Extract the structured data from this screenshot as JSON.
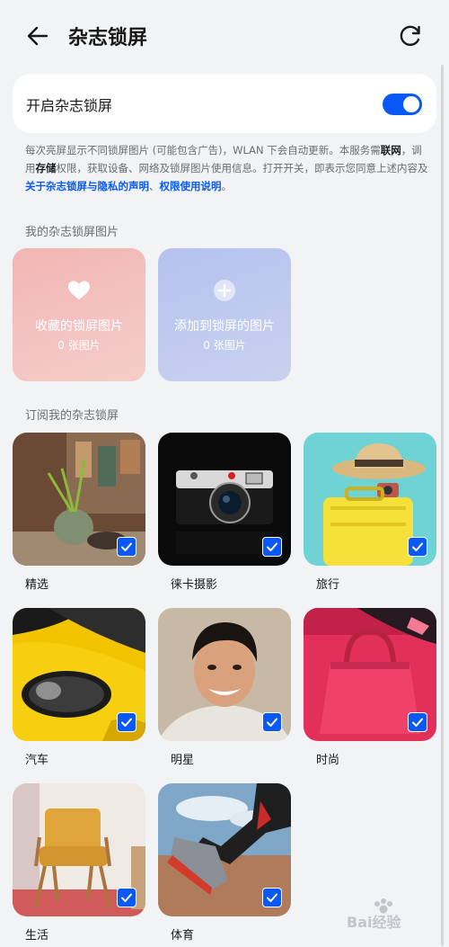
{
  "header": {
    "back_icon": "arrow-left-icon",
    "title": "杂志锁屏",
    "refresh_icon": "refresh-icon"
  },
  "toggle": {
    "label": "开启杂志锁屏",
    "enabled": true,
    "accent_color": "#0a59f7"
  },
  "description": {
    "part1": "每次亮屏显示不同锁屏图片 (可能包含广告)，WLAN 下会自动更新。本服务需",
    "bold1": "联网",
    "part2": "，调用",
    "bold2": "存储",
    "part3": "权限，获取设备、网络及锁屏图片使用信息。打开开关，即表示您同意上述内容及",
    "link1": "关于杂志锁屏与隐私的声明",
    "sep": "、",
    "link2": "权限使用说明",
    "end": "。"
  },
  "my_images": {
    "section_title": "我的杂志锁屏图片",
    "favorites": {
      "title": "收藏的锁屏图片",
      "count": "0 张图片",
      "icon": "heart-icon"
    },
    "added": {
      "title": "添加到锁屏的图片",
      "count": "0 张图片",
      "icon": "plus-circle-icon"
    }
  },
  "subscriptions": {
    "section_title": "订阅我的杂志锁屏",
    "check_icon": "checkbox-checked-icon",
    "items": [
      {
        "label": "精选",
        "checked": true
      },
      {
        "label": "徕卡摄影",
        "checked": true
      },
      {
        "label": "旅行",
        "checked": true
      },
      {
        "label": "汽车",
        "checked": true
      },
      {
        "label": "明星",
        "checked": true
      },
      {
        "label": "时尚",
        "checked": true
      },
      {
        "label": "生活",
        "checked": true
      },
      {
        "label": "体育",
        "checked": true
      }
    ]
  },
  "watermark": {
    "text": "Bai经验"
  }
}
